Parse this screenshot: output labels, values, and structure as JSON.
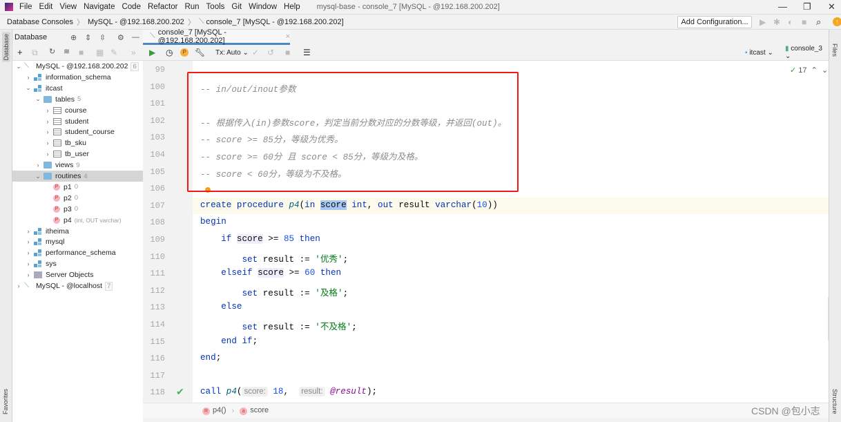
{
  "menu": {
    "items": [
      "File",
      "Edit",
      "View",
      "Navigate",
      "Code",
      "Refactor",
      "Run",
      "Tools",
      "Git",
      "Window",
      "Help"
    ],
    "title": "mysql-base - console_7 [MySQL - @192.168.200.202]"
  },
  "breadcrumb": [
    "Database Consoles",
    "MySQL - @192.168.200.202",
    "console_7 [MySQL - @192.168.200.202]"
  ],
  "run_toolbar": {
    "add_configuration": "Add Configuration..."
  },
  "side_stripes": {
    "left_top": "Database",
    "left_bottom": "Favorites",
    "right_top": "Files",
    "right_bottom": "Structure"
  },
  "database_panel": {
    "title": "Database",
    "tree": [
      {
        "label": "MySQL - @192.168.200.202",
        "count": "6",
        "icon": "conn",
        "depth": 0,
        "chev": "v",
        "countbox": true
      },
      {
        "label": "information_schema",
        "icon": "db",
        "depth": 1,
        "chev": ">"
      },
      {
        "label": "itcast",
        "icon": "db",
        "depth": 1,
        "chev": "v"
      },
      {
        "label": "tables",
        "count": "5",
        "icon": "folder",
        "depth": 2,
        "chev": "v"
      },
      {
        "label": "course",
        "icon": "table",
        "depth": 3,
        "chev": ">"
      },
      {
        "label": "student",
        "icon": "table",
        "depth": 3,
        "chev": ">"
      },
      {
        "label": "student_course",
        "icon": "table",
        "depth": 3,
        "chev": ">"
      },
      {
        "label": "tb_sku",
        "icon": "table",
        "depth": 3,
        "chev": ">"
      },
      {
        "label": "tb_user",
        "icon": "table",
        "depth": 3,
        "chev": ">"
      },
      {
        "label": "views",
        "count": "9",
        "icon": "folder",
        "depth": 2,
        "chev": ">"
      },
      {
        "label": "routines",
        "count": "4",
        "icon": "folder",
        "depth": 2,
        "chev": "v",
        "selected": true
      },
      {
        "label": "p1",
        "count": "0",
        "icon": "proc",
        "depth": 3,
        "chev": ""
      },
      {
        "label": "p2",
        "count": "0",
        "icon": "proc",
        "depth": 3,
        "chev": ""
      },
      {
        "label": "p3",
        "count": "0",
        "icon": "proc",
        "depth": 3,
        "chev": ""
      },
      {
        "label": "p4",
        "sig": "(int, OUT varchar)",
        "icon": "proc",
        "depth": 3,
        "chev": ""
      },
      {
        "label": "itheima",
        "icon": "db",
        "depth": 1,
        "chev": ">"
      },
      {
        "label": "mysql",
        "icon": "db",
        "depth": 1,
        "chev": ">"
      },
      {
        "label": "performance_schema",
        "icon": "db",
        "depth": 1,
        "chev": ">"
      },
      {
        "label": "sys",
        "icon": "db",
        "depth": 1,
        "chev": ">"
      },
      {
        "label": "Server Objects",
        "icon": "srv",
        "depth": 1,
        "chev": ">"
      },
      {
        "label": "MySQL - @localhost",
        "count": "7",
        "icon": "conn",
        "depth": 0,
        "chev": ">",
        "countbox": true
      }
    ]
  },
  "editor": {
    "tab": "console_7 [MySQL - @192.168.200.202]",
    "toolbar": {
      "tx": "Tx: Auto",
      "schema": "itcast",
      "session": "console_3",
      "check_count": "17"
    },
    "lines": [
      {
        "n": "99",
        "tokens": []
      },
      {
        "n": "100",
        "tokens": [
          {
            "t": "-- in/out/inout参数",
            "c": "c"
          }
        ]
      },
      {
        "n": "101",
        "tokens": []
      },
      {
        "n": "102",
        "tokens": [
          {
            "t": "-- 根据传入(in)参数score，判定当前分数对应的分数等级，并返回(out)。",
            "c": "c"
          }
        ]
      },
      {
        "n": "103",
        "tokens": [
          {
            "t": "-- score >= 85分，等级为优秀。",
            "c": "c"
          }
        ]
      },
      {
        "n": "104",
        "tokens": [
          {
            "t": "-- score >= 60分 且 score < 85分，等级为及格。",
            "c": "c"
          }
        ]
      },
      {
        "n": "105",
        "tokens": [
          {
            "t": "-- score < 60分，等级为不及格。",
            "c": "c"
          }
        ]
      },
      {
        "n": "106",
        "tokens": []
      },
      {
        "n": "107",
        "current": true,
        "tokens": [
          {
            "t": "create procedure ",
            "c": "k"
          },
          {
            "t": "p4",
            "c": "f"
          },
          {
            "t": "(",
            "c": ""
          },
          {
            "t": "in ",
            "c": "k"
          },
          {
            "t": "score",
            "c": "hl"
          },
          {
            "t": " int",
            "c": "k"
          },
          {
            "t": ", ",
            "c": ""
          },
          {
            "t": "out ",
            "c": "k"
          },
          {
            "t": "result ",
            "c": ""
          },
          {
            "t": "varchar",
            "c": "k"
          },
          {
            "t": "(",
            "c": ""
          },
          {
            "t": "10",
            "c": "n"
          },
          {
            "t": "))",
            "c": ""
          }
        ]
      },
      {
        "n": "108",
        "tokens": [
          {
            "t": "begin",
            "c": "k"
          }
        ]
      },
      {
        "n": "109",
        "tokens": [
          {
            "t": "    if ",
            "c": "k"
          },
          {
            "t": "score",
            "c": "hl2"
          },
          {
            "t": " >= ",
            "c": ""
          },
          {
            "t": "85",
            "c": "n"
          },
          {
            "t": " then",
            "c": "k"
          }
        ]
      },
      {
        "n": "110",
        "tokens": [
          {
            "t": "        set ",
            "c": "k"
          },
          {
            "t": "result := ",
            "c": ""
          },
          {
            "t": "'优秀'",
            "c": "s"
          },
          {
            "t": ";",
            "c": ""
          }
        ]
      },
      {
        "n": "111",
        "tokens": [
          {
            "t": "    elseif ",
            "c": "k"
          },
          {
            "t": "score",
            "c": "hl2"
          },
          {
            "t": " >= ",
            "c": ""
          },
          {
            "t": "60",
            "c": "n"
          },
          {
            "t": " then",
            "c": "k"
          }
        ]
      },
      {
        "n": "112",
        "tokens": [
          {
            "t": "        set ",
            "c": "k"
          },
          {
            "t": "result := ",
            "c": ""
          },
          {
            "t": "'及格'",
            "c": "s"
          },
          {
            "t": ";",
            "c": ""
          }
        ]
      },
      {
        "n": "113",
        "tokens": [
          {
            "t": "    else",
            "c": "k"
          }
        ]
      },
      {
        "n": "114",
        "tokens": [
          {
            "t": "        set ",
            "c": "k"
          },
          {
            "t": "result := ",
            "c": ""
          },
          {
            "t": "'不及格'",
            "c": "s"
          },
          {
            "t": ";",
            "c": ""
          }
        ]
      },
      {
        "n": "115",
        "tokens": [
          {
            "t": "    end if",
            "c": "k"
          },
          {
            "t": ";",
            "c": ""
          }
        ]
      },
      {
        "n": "116",
        "tokens": [
          {
            "t": "end",
            "c": "k"
          },
          {
            "t": ";",
            "c": ""
          }
        ]
      },
      {
        "n": "117",
        "tokens": []
      },
      {
        "n": "118",
        "check": true,
        "tokens": [
          {
            "t": "call ",
            "c": "k"
          },
          {
            "t": "p4",
            "c": "f"
          },
          {
            "t": "(",
            "c": ""
          },
          {
            "t": "score:",
            "c": "hint"
          },
          {
            "t": " ",
            "c": ""
          },
          {
            "t": "18",
            "c": "n"
          },
          {
            "t": ",  ",
            "c": ""
          },
          {
            "t": "result:",
            "c": "hint"
          },
          {
            "t": " ",
            "c": ""
          },
          {
            "t": "@result",
            "c": "v"
          },
          {
            "t": ");",
            "c": ""
          }
        ]
      }
    ],
    "breadcrumb": [
      {
        "badge": "R",
        "label": "p4()"
      },
      {
        "badge": "a",
        "label": "score"
      }
    ]
  },
  "watermark": "CSDN @包小志",
  "colors": {
    "accent": "#4a88c7",
    "annotation_box": "#f01818"
  }
}
